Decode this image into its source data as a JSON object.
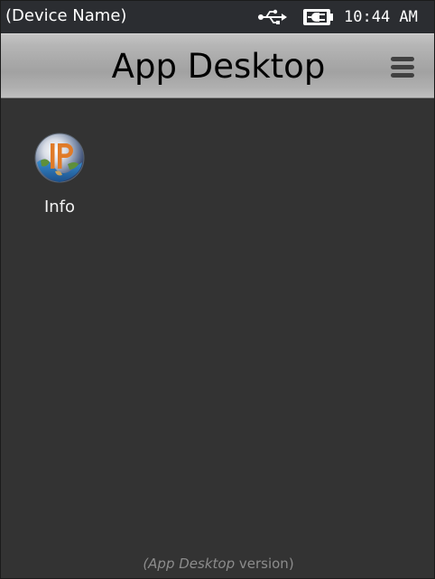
{
  "status_bar": {
    "device_name": "(Device Name)",
    "time": "10:44 AM",
    "icons": [
      "usb-icon",
      "battery-charging-icon"
    ]
  },
  "title_bar": {
    "title": "App Desktop",
    "menu_icon": "hamburger-menu-icon"
  },
  "desktop": {
    "apps": [
      {
        "label": "Info",
        "icon": "info-ip-globe-icon",
        "icon_letters": "IP"
      }
    ]
  },
  "footer": {
    "open_paren": "(",
    "app_name": "App Desktop",
    "suffix": " version)"
  },
  "colors": {
    "background": "#333333",
    "status_bar": "#2b2d31",
    "title_bar": "#a8a8a8",
    "footer_text": "#8c8c8c",
    "icon_letter": "#e07b28"
  }
}
